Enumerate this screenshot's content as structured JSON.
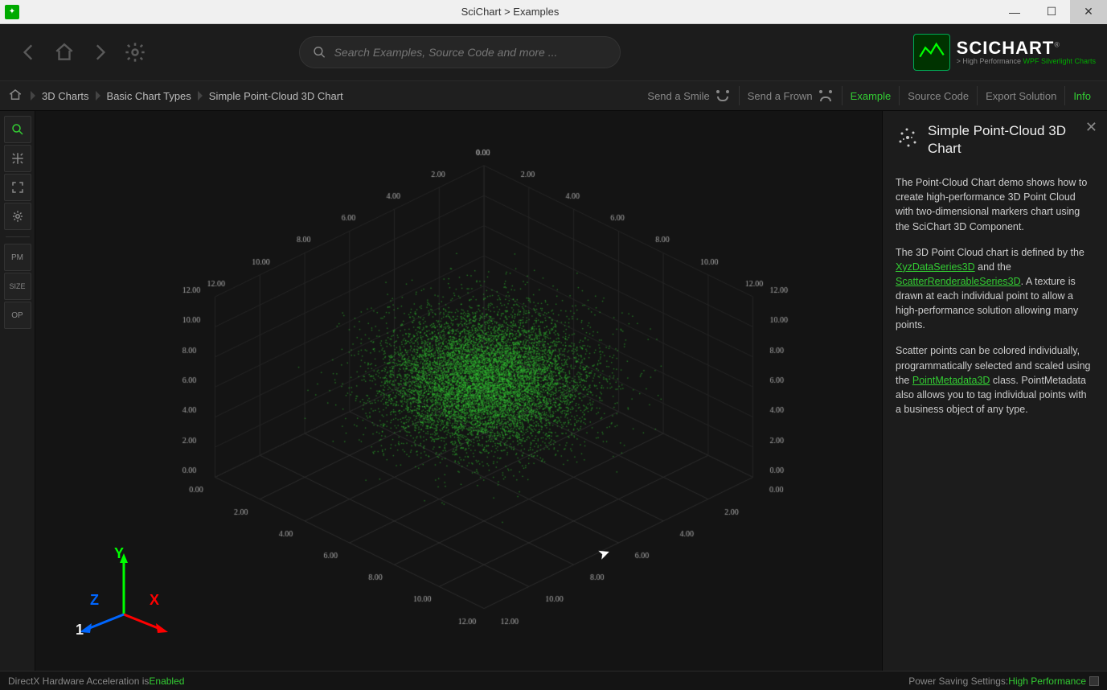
{
  "window": {
    "title": "SciChart > Examples"
  },
  "search": {
    "placeholder": "Search Examples, Source Code and more ..."
  },
  "logo": {
    "name": "SCICHART",
    "tag_prefix": "> High Performance ",
    "tag_accent": "WPF Silverlight Charts",
    "trademark": "®"
  },
  "breadcrumbs": [
    "3D Charts",
    "Basic Chart Types",
    "Simple Point-Cloud 3D Chart"
  ],
  "rhs": {
    "smile": "Send a Smile",
    "frown": "Send a Frown",
    "example": "Example",
    "source": "Source Code",
    "export": "Export Solution",
    "info": "Info"
  },
  "left_tools": {
    "pm": "PM",
    "size": "SIZE",
    "op": "OP"
  },
  "info_panel": {
    "title": "Simple Point-Cloud 3D Chart",
    "p1": "The Point-Cloud Chart demo shows how to create high-performance 3D Point Cloud with two-dimensional markers chart using the SciChart 3D Component.",
    "p2a": "The 3D Point Cloud chart is defined by the ",
    "link1": "XyzDataSeries3D",
    "p2b": " and the ",
    "link2": "ScatterRenderableSeries3D",
    "p2c": ". A texture is drawn at each individual point to allow a high-performance solution allowing many points.",
    "p3a": "Scatter points can be colored individually, programmatically selected and scaled using the ",
    "link3": "PointMetadata3D",
    "p3b": " class. PointMetadata also allows you to tag individual points with a business object of any type."
  },
  "status": {
    "hw_prefix": "DirectX Hardware Acceleration is ",
    "hw_value": "Enabled",
    "ps_prefix": "Power Saving Settings: ",
    "ps_value": "High Performance"
  },
  "chart_overlay_number": "1",
  "gizmo": {
    "x": "X",
    "y": "Y",
    "z": "Z"
  },
  "chart_data": {
    "type": "scatter",
    "description": "3D point-cloud, ~10000 points normally distributed around center (5,5,5)",
    "n_points": 10000,
    "distribution": "gaussian",
    "center": [
      5,
      5,
      5
    ],
    "sigma": [
      1.6,
      1.6,
      1.6
    ],
    "axis_ticks": [
      "0.00",
      "2.00",
      "4.00",
      "6.00",
      "8.00",
      "10.00",
      "12.00"
    ],
    "x_range": [
      0,
      12
    ],
    "y_range": [
      0,
      12
    ],
    "z_range": [
      0,
      12
    ],
    "point_color": "#3c3"
  }
}
